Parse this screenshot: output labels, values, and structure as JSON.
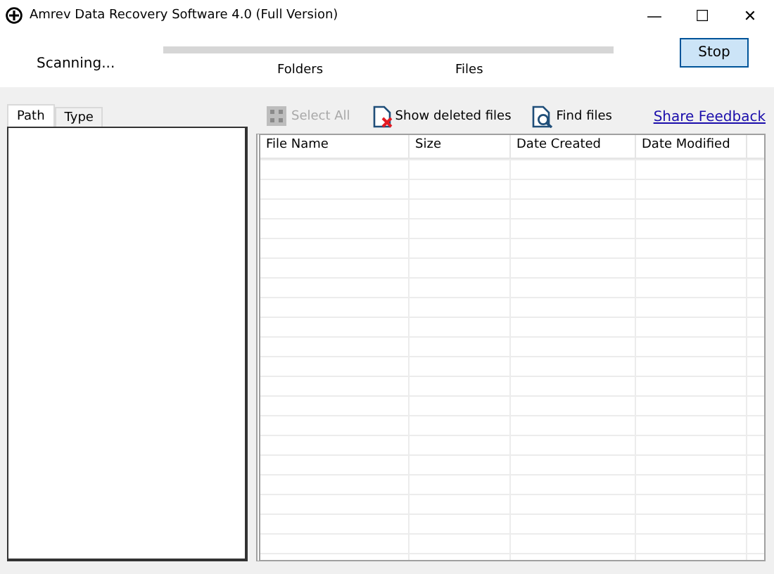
{
  "window": {
    "title": "Amrev Data Recovery Software 4.0 (Full Version)",
    "controls": [
      "—",
      "☐",
      "✕"
    ]
  },
  "scan": {
    "status": "Scanning...",
    "progress": {
      "level": 0
    },
    "folders_label": "Folders",
    "files_label": "Files",
    "stop_button": "Stop"
  },
  "tabs": [
    {
      "label": "Path",
      "selected": true
    },
    {
      "label": "Type",
      "selected": false
    }
  ],
  "toolbar": [
    {
      "label": "Select All",
      "disabled": true,
      "kind": "grid"
    },
    {
      "label": "Show deleted files",
      "disabled": false,
      "kind": "deleted"
    },
    {
      "label": "Find files",
      "disabled": false,
      "kind": "find"
    }
  ],
  "share_link": "Share Feedback",
  "table": {
    "columns": [
      "File Name",
      "Size",
      "Date Created",
      "Date Modified"
    ]
  }
}
